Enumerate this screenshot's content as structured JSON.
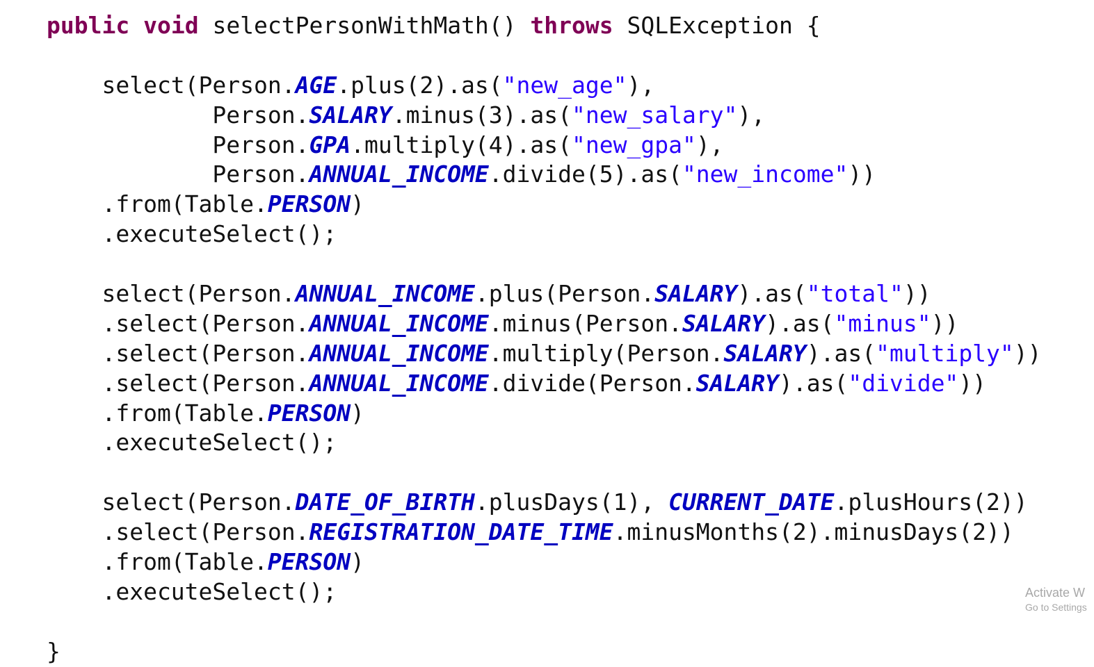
{
  "code_lines": [
    [
      {
        "t": "kw",
        "v": "public"
      },
      {
        "t": "plain",
        "v": " "
      },
      {
        "t": "kw",
        "v": "void"
      },
      {
        "t": "plain",
        "v": " selectPersonWithMath() "
      },
      {
        "t": "kw",
        "v": "throws"
      },
      {
        "t": "plain",
        "v": " SQLException {"
      }
    ],
    [],
    [
      {
        "t": "plain",
        "v": "    select(Person."
      },
      {
        "t": "fld",
        "v": "AGE"
      },
      {
        "t": "plain",
        "v": ".plus(2).as("
      },
      {
        "t": "str",
        "v": "\"new_age\""
      },
      {
        "t": "plain",
        "v": "),"
      }
    ],
    [
      {
        "t": "plain",
        "v": "            Person."
      },
      {
        "t": "fld",
        "v": "SALARY"
      },
      {
        "t": "plain",
        "v": ".minus(3).as("
      },
      {
        "t": "str",
        "v": "\"new_salary\""
      },
      {
        "t": "plain",
        "v": "),"
      }
    ],
    [
      {
        "t": "plain",
        "v": "            Person."
      },
      {
        "t": "fld",
        "v": "GPA"
      },
      {
        "t": "plain",
        "v": ".multiply(4).as("
      },
      {
        "t": "str",
        "v": "\"new_gpa\""
      },
      {
        "t": "plain",
        "v": "),"
      }
    ],
    [
      {
        "t": "plain",
        "v": "            Person."
      },
      {
        "t": "fld",
        "v": "ANNUAL_INCOME"
      },
      {
        "t": "plain",
        "v": ".divide(5).as("
      },
      {
        "t": "str",
        "v": "\"new_income\""
      },
      {
        "t": "plain",
        "v": "))"
      }
    ],
    [
      {
        "t": "plain",
        "v": "    .from(Table."
      },
      {
        "t": "fld",
        "v": "PERSON"
      },
      {
        "t": "plain",
        "v": ")"
      }
    ],
    [
      {
        "t": "plain",
        "v": "    .executeSelect();"
      }
    ],
    [],
    [
      {
        "t": "plain",
        "v": "    select(Person."
      },
      {
        "t": "fld",
        "v": "ANNUAL_INCOME"
      },
      {
        "t": "plain",
        "v": ".plus(Person."
      },
      {
        "t": "fld",
        "v": "SALARY"
      },
      {
        "t": "plain",
        "v": ").as("
      },
      {
        "t": "str",
        "v": "\"total\""
      },
      {
        "t": "plain",
        "v": "))"
      }
    ],
    [
      {
        "t": "plain",
        "v": "    .select(Person."
      },
      {
        "t": "fld",
        "v": "ANNUAL_INCOME"
      },
      {
        "t": "plain",
        "v": ".minus(Person."
      },
      {
        "t": "fld",
        "v": "SALARY"
      },
      {
        "t": "plain",
        "v": ").as("
      },
      {
        "t": "str",
        "v": "\"minus\""
      },
      {
        "t": "plain",
        "v": "))"
      }
    ],
    [
      {
        "t": "plain",
        "v": "    .select(Person."
      },
      {
        "t": "fld",
        "v": "ANNUAL_INCOME"
      },
      {
        "t": "plain",
        "v": ".multiply(Person."
      },
      {
        "t": "fld",
        "v": "SALARY"
      },
      {
        "t": "plain",
        "v": ").as("
      },
      {
        "t": "str",
        "v": "\"multiply\""
      },
      {
        "t": "plain",
        "v": "))"
      }
    ],
    [
      {
        "t": "plain",
        "v": "    .select(Person."
      },
      {
        "t": "fld",
        "v": "ANNUAL_INCOME"
      },
      {
        "t": "plain",
        "v": ".divide(Person."
      },
      {
        "t": "fld",
        "v": "SALARY"
      },
      {
        "t": "plain",
        "v": ").as("
      },
      {
        "t": "str",
        "v": "\"divide\""
      },
      {
        "t": "plain",
        "v": "))"
      }
    ],
    [
      {
        "t": "plain",
        "v": "    .from(Table."
      },
      {
        "t": "fld",
        "v": "PERSON"
      },
      {
        "t": "plain",
        "v": ")"
      }
    ],
    [
      {
        "t": "plain",
        "v": "    .executeSelect();"
      }
    ],
    [],
    [
      {
        "t": "plain",
        "v": "    select(Person."
      },
      {
        "t": "fld",
        "v": "DATE_OF_BIRTH"
      },
      {
        "t": "plain",
        "v": ".plusDays(1), "
      },
      {
        "t": "fld",
        "v": "CURRENT_DATE"
      },
      {
        "t": "plain",
        "v": ".plusHours(2))"
      }
    ],
    [
      {
        "t": "plain",
        "v": "    .select(Person."
      },
      {
        "t": "fld",
        "v": "REGISTRATION_DATE_TIME"
      },
      {
        "t": "plain",
        "v": ".minusMonths(2).minusDays(2))"
      }
    ],
    [
      {
        "t": "plain",
        "v": "    .from(Table."
      },
      {
        "t": "fld",
        "v": "PERSON"
      },
      {
        "t": "plain",
        "v": ")"
      }
    ],
    [
      {
        "t": "plain",
        "v": "    .executeSelect();"
      }
    ],
    [],
    [
      {
        "t": "plain",
        "v": "}"
      }
    ]
  ],
  "watermark": {
    "title": "Activate W",
    "subtitle": "Go to Settings"
  },
  "colors": {
    "background": "#ffffff",
    "text": "#111111",
    "keyword": "#7f0055",
    "field": "#0000c0",
    "string": "#2a00ff",
    "watermark": "#a8a8a8"
  }
}
